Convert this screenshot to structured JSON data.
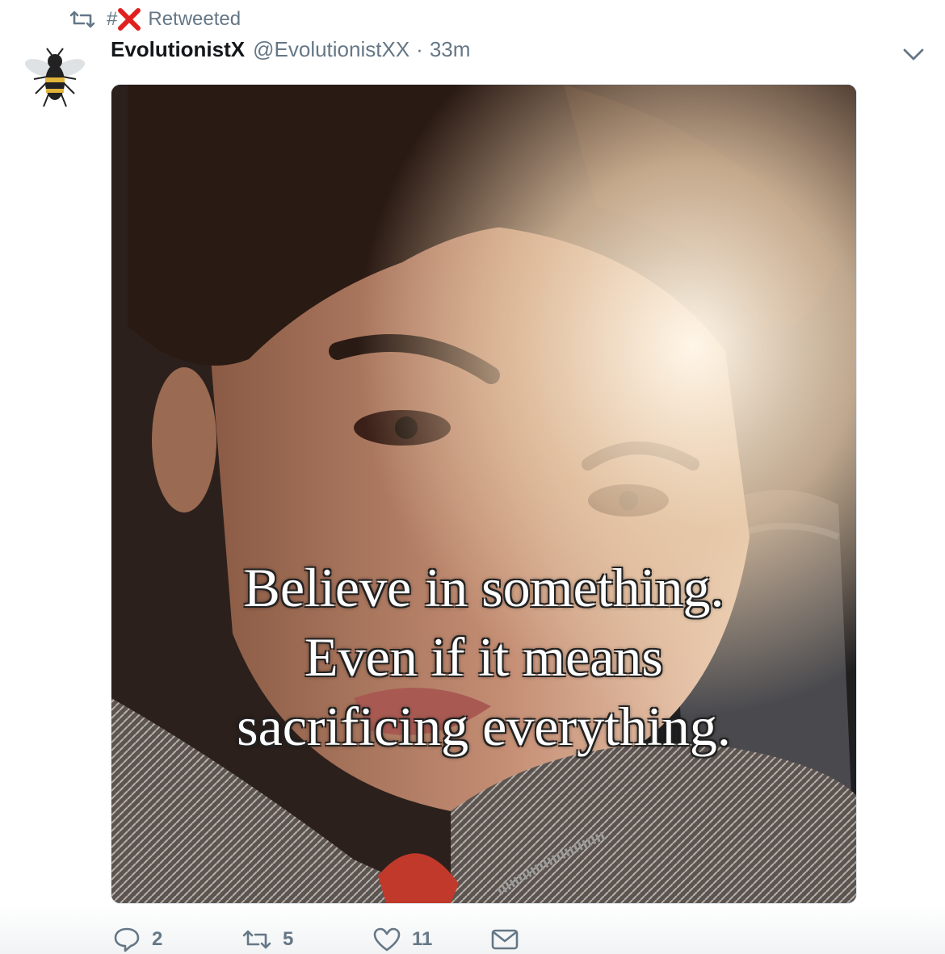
{
  "retweet_context": {
    "hashtag_prefix": "#",
    "label": "Retweeted"
  },
  "tweet": {
    "display_name": "EvolutionistX",
    "handle": "@EvolutionistXX",
    "separator": "·",
    "time": "33m",
    "image_caption_lines": [
      "Believe in something.",
      "Even if it means",
      "sacrificing everything."
    ]
  },
  "actions": {
    "reply_count": "2",
    "retweet_count": "5",
    "like_count": "11"
  },
  "colors": {
    "muted": "#657786",
    "name": "#14171a",
    "x_mark": "#e0201f"
  },
  "icons": [
    "retweet-icon",
    "red-x-icon",
    "bee-avatar",
    "caret-down-icon",
    "reply-icon",
    "retweet-icon",
    "heart-icon",
    "mail-icon"
  ]
}
